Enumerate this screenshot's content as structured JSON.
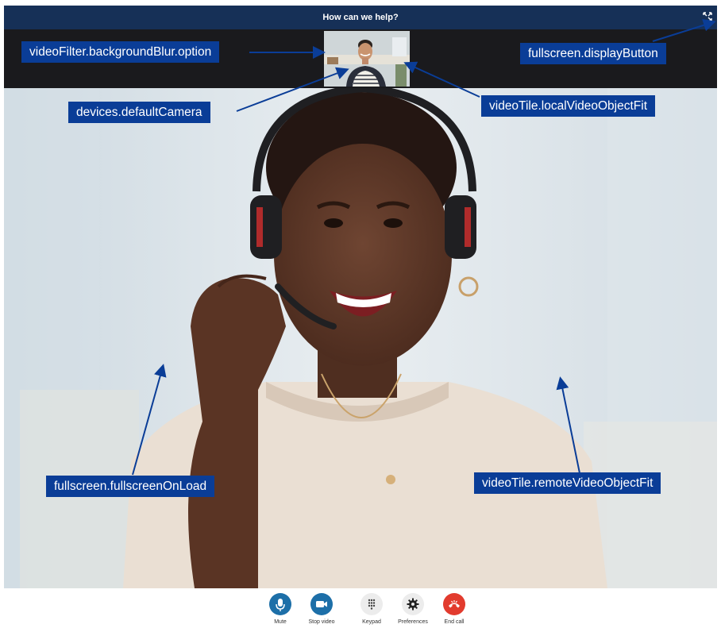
{
  "header": {
    "title": "How can we help?"
  },
  "controls": [
    {
      "label": "Mute",
      "icon": "microphone-icon",
      "color": "#1d6fa8"
    },
    {
      "label": "Stop video",
      "icon": "video-camera-icon",
      "color": "#1d6fa8"
    },
    {
      "label": "Keypad",
      "icon": "keypad-icon",
      "color": "#ececec"
    },
    {
      "label": "Preferences",
      "icon": "gear-icon",
      "color": "#ececec"
    },
    {
      "label": "End call",
      "icon": "end-call-icon",
      "color": "#e23b2e"
    }
  ],
  "annotations": {
    "background_blur": "videoFilter.backgroundBlur.option",
    "display_button": "fullscreen.displayButton",
    "default_camera": "devices.defaultCamera",
    "local_object_fit": "videoTile.localVideoObjectFit",
    "fullscreen_on_load": "fullscreen.fullscreenOnLoad",
    "remote_object_fit": "videoTile.remoteVideoObjectFit"
  },
  "colors": {
    "header_bg": "#163057",
    "strip_bg": "#1a1a1d",
    "callout_bg": "#0a3d97",
    "arrow": "#0a3d97"
  }
}
